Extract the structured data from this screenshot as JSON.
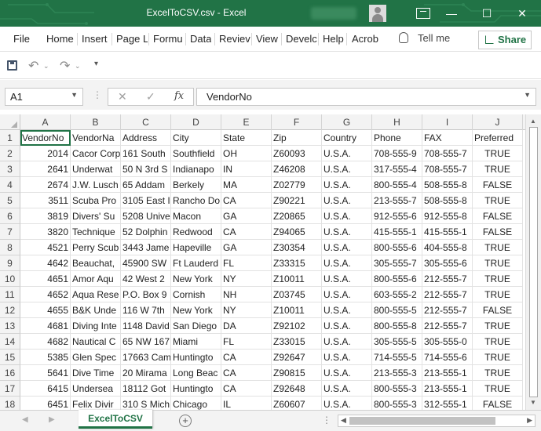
{
  "window": {
    "title": "ExcelToCSV.csv  -  Excel",
    "minimize_glyph": "—",
    "maximize_glyph": "☐",
    "close_glyph": "✕"
  },
  "menu": {
    "items": [
      "File",
      "Home",
      "Insert",
      "Page L",
      "Formu",
      "Data",
      "Reviev",
      "View",
      "Develc",
      "Help",
      "Acrob"
    ],
    "tell_me": "Tell me",
    "share": "Share"
  },
  "quick_access": {
    "undo_glyph": "↶",
    "redo_glyph": "↷",
    "dropdown_glyph": "⌄",
    "customize_glyph": "▾"
  },
  "formula_bar": {
    "name_box": "A1",
    "formula": "VendorNo",
    "cancel_glyph": "✕",
    "enter_glyph": "✓",
    "fx_glyph": "fx",
    "dots": "⋮"
  },
  "columns": [
    "A",
    "B",
    "C",
    "D",
    "E",
    "F",
    "G",
    "H",
    "I",
    "J"
  ],
  "rows": [
    [
      "VendorNo",
      "VendorNa",
      "Address",
      "City",
      "State",
      "Zip",
      "Country",
      "Phone",
      "FAX",
      "Preferred"
    ],
    [
      "2014",
      "Cacor Corp",
      "161 South",
      "Southfield",
      "OH",
      "Z60093",
      "U.S.A.",
      "708-555-9",
      "708-555-7",
      "TRUE"
    ],
    [
      "2641",
      "Underwat",
      "50 N 3rd S",
      "Indianapo",
      "IN",
      "Z46208",
      "U.S.A.",
      "317-555-4",
      "708-555-7",
      "TRUE"
    ],
    [
      "2674",
      "J.W.  Lusch",
      "65 Addam",
      "Berkely",
      "MA",
      "Z02779",
      "U.S.A.",
      "800-555-4",
      "508-555-8",
      "FALSE"
    ],
    [
      "3511",
      "Scuba Pro",
      "3105 East I",
      "Rancho Do",
      "CA",
      "Z90221",
      "U.S.A.",
      "213-555-7",
      "508-555-8",
      "TRUE"
    ],
    [
      "3819",
      "Divers'  Su",
      "5208 Unive",
      "Macon",
      "GA",
      "Z20865",
      "U.S.A.",
      "912-555-6",
      "912-555-8",
      "FALSE"
    ],
    [
      "3820",
      "Technique",
      "52 Dolphin",
      "Redwood",
      "CA",
      "Z94065",
      "U.S.A.",
      "415-555-1",
      "415-555-1",
      "FALSE"
    ],
    [
      "4521",
      "Perry Scub",
      "3443 Jame",
      "Hapeville",
      "GA",
      "Z30354",
      "U.S.A.",
      "800-555-6",
      "404-555-8",
      "TRUE"
    ],
    [
      "4642",
      "Beauchat,",
      "45900 SW",
      "Ft Lauderd",
      "FL",
      "Z33315",
      "U.S.A.",
      "305-555-7",
      "305-555-6",
      "TRUE"
    ],
    [
      "4651",
      "Amor Aqu",
      "42 West 2",
      "New York",
      "NY",
      "Z10011",
      "U.S.A.",
      "800-555-6",
      "212-555-7",
      "TRUE"
    ],
    [
      "4652",
      "Aqua Rese",
      "P.O. Box 9",
      "Cornish",
      "NH",
      "Z03745",
      "U.S.A.",
      "603-555-2",
      "212-555-7",
      "TRUE"
    ],
    [
      "4655",
      "B&K Unde",
      "116 W 7th",
      "New York",
      "NY",
      "Z10011",
      "U.S.A.",
      "800-555-5",
      "212-555-7",
      "FALSE"
    ],
    [
      "4681",
      "Diving Inte",
      "1148 David",
      "San Diego",
      "DA",
      "Z92102",
      "U.S.A.",
      "800-555-8",
      "212-555-7",
      "TRUE"
    ],
    [
      "4682",
      "Nautical C",
      "65 NW 167",
      "Miami",
      "FL",
      "Z33015",
      "U.S.A.",
      "305-555-5",
      "305-555-0",
      "TRUE"
    ],
    [
      "5385",
      "Glen Spec",
      "17663 Cam",
      "Huntingto",
      "CA",
      "Z92647",
      "U.S.A.",
      "714-555-5",
      "714-555-6",
      "TRUE"
    ],
    [
      "5641",
      "Dive Time",
      "20 Mirama",
      "Long Beac",
      "CA",
      "Z90815",
      "U.S.A.",
      "213-555-3",
      "213-555-1",
      "TRUE"
    ],
    [
      "6415",
      "Undersea",
      "18112 Got",
      "Huntingto",
      "CA",
      "Z92648",
      "U.S.A.",
      "800-555-3",
      "213-555-1",
      "TRUE"
    ],
    [
      "6451",
      "Felix Divir",
      "310 S Mich",
      "Chicago",
      "IL",
      "Z60607",
      "U.S.A.",
      "800-555-3",
      "312-555-1",
      "FALSE"
    ]
  ],
  "sheet": {
    "tab": "ExcelToCSV",
    "add_glyph": "+",
    "dots": "⋮"
  },
  "colors": {
    "brand": "#217346",
    "header_bg": "#f3f3f3",
    "grid": "#e2e2e2"
  }
}
